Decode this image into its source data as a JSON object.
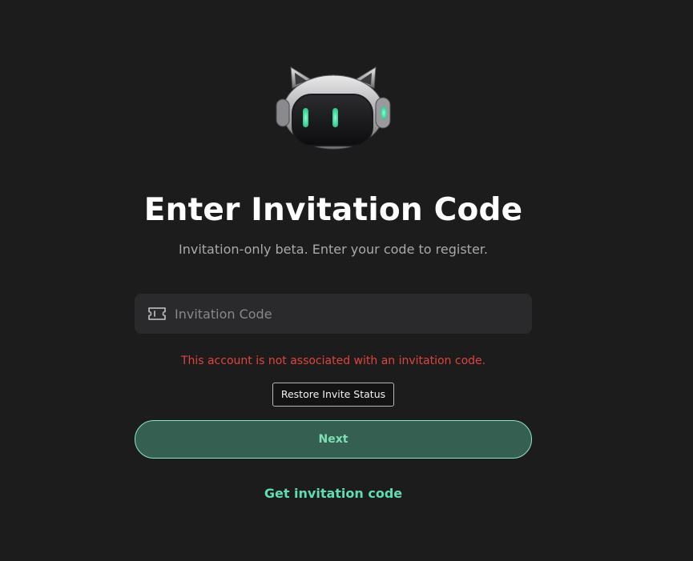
{
  "header": {
    "mascot_icon": "robot-cat-icon",
    "title": "Enter Invitation Code",
    "subtitle": "Invitation-only beta. Enter your code to register."
  },
  "form": {
    "code_field": {
      "icon": "ticket-icon",
      "placeholder": "Invitation Code",
      "value": ""
    },
    "error_message": "This account is not associated with an invitation code.",
    "restore_label": "Restore Invite Status",
    "next_label": "Next",
    "get_code_label": "Get invitation code"
  },
  "colors": {
    "background": "#1c1c1d",
    "accent": "#5fdcb0",
    "error": "#e0443e",
    "button_fill": "#355f50"
  }
}
